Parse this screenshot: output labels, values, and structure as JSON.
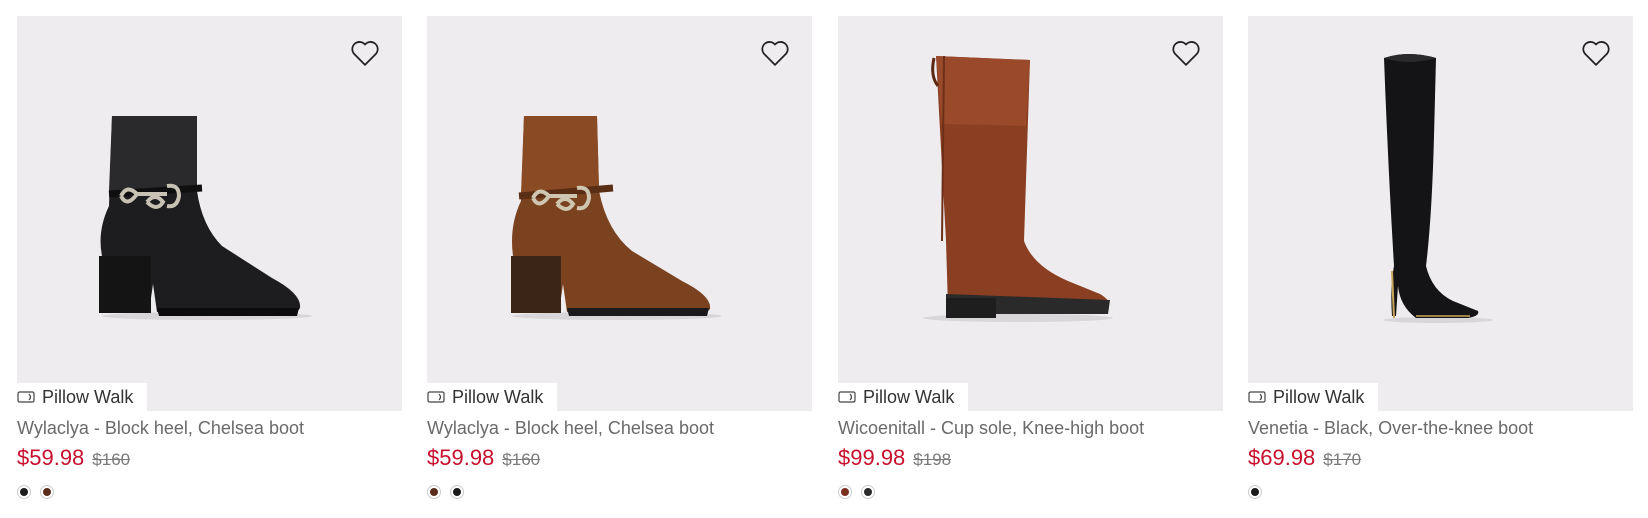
{
  "badge_label": "Pillow Walk",
  "products": [
    {
      "name": "Wylaclya - Block heel, Chelsea boot",
      "sale_price": "$59.98",
      "original_price": "$160",
      "swatches": [
        "#1c1c1c",
        "#5a2d1a"
      ]
    },
    {
      "name": "Wylaclya - Block heel, Chelsea boot",
      "sale_price": "$59.98",
      "original_price": "$160",
      "swatches": [
        "#5a2d1a",
        "#1c1c1c"
      ]
    },
    {
      "name": "Wicoenitall - Cup sole, Knee-high boot",
      "sale_price": "$99.98",
      "original_price": "$198",
      "swatches": [
        "#7a2e1e",
        "#2a2a2a"
      ]
    },
    {
      "name": "Venetia - Black, Over-the-knee boot",
      "sale_price": "$69.98",
      "original_price": "$170",
      "swatches": [
        "#1c1c1c"
      ]
    }
  ],
  "colors": {
    "sale": "#c8102e",
    "card_background": "#eeecee"
  },
  "icons": {
    "wishlist": "heart-outline-icon",
    "badge": "insole-icon"
  }
}
